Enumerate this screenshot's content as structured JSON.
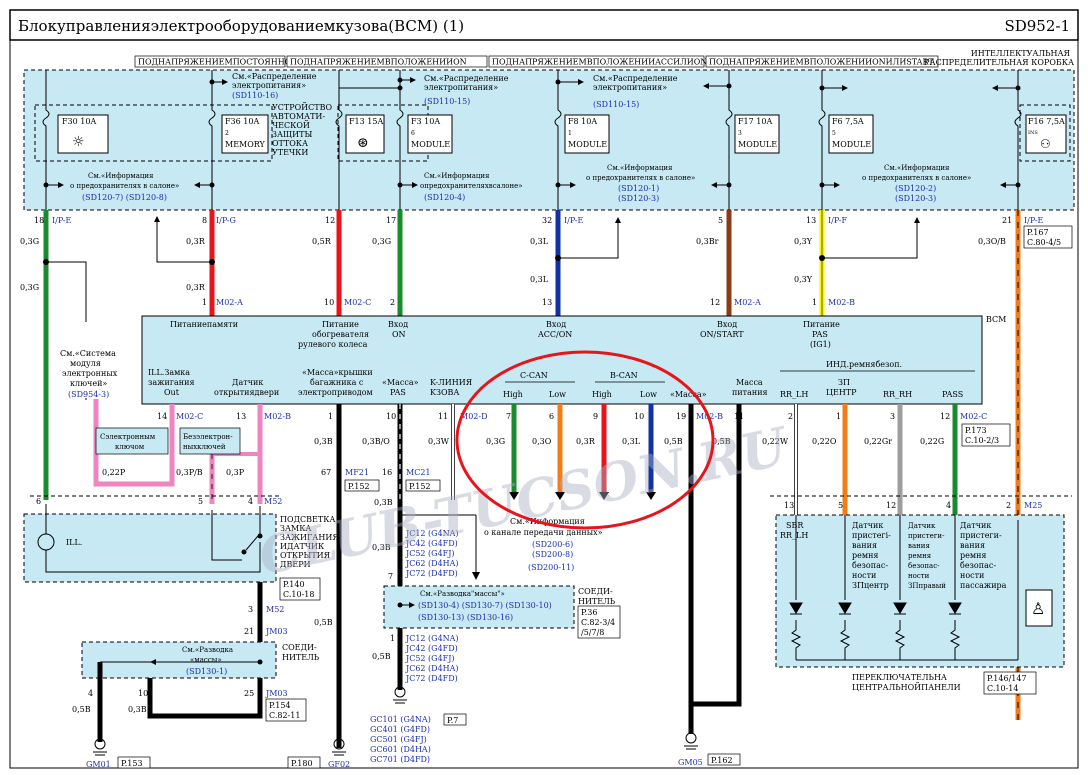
{
  "header": {
    "title": "Блокуправленияэлектрооборудованиемкузова(BCM) (1)",
    "code": "SD952-1"
  },
  "power_labels": [
    "ПОДНАПРЯЖЕНИЕМПОСТОЯННО",
    "ПОДНАПРЯЖЕНИЕМВПОЛОЖЕНИИON",
    "ПОДНАПРЯЖЕНИЕМВПОЛОЖЕНИИACCИЛИON",
    "ПОДНАПРЯЖЕНИЕМВПОЛОЖЕНИИONИЛИSTART"
  ],
  "junction_box": {
    "line1": "ИНТЕЛЛЕКТУАЛЬНАЯ",
    "line2": "РАСПРЕДЕЛИТЕЛЬНАЯ КОРОБКА"
  },
  "fuses": [
    {
      "id": "F30 10A",
      "sub": "",
      "name": ""
    },
    {
      "id": "F36 10A",
      "sub": "2",
      "name": "MEMORY"
    },
    {
      "id": "F13 15A",
      "sub": "",
      "name": ""
    },
    {
      "id": "F3 10A",
      "sub": "6",
      "name": "MODULE"
    },
    {
      "id": "F8 10A",
      "sub": "1",
      "name": "MODULE"
    },
    {
      "id": "F17 10A",
      "sub": "3",
      "name": "MODULE"
    },
    {
      "id": "F6 7,5A",
      "sub": "5",
      "name": "MODULE"
    },
    {
      "id": "F16 7,5A",
      "sub": "INS",
      "name": ""
    }
  ],
  "refs": {
    "dist1": "См.«Распределение",
    "dist2": "электропитания»",
    "dist_sd1": "(SD110-16)",
    "dist_sd2": "(SD110-15)",
    "dist_sd3": "(SD110-15)",
    "leak": [
      "УСТРОЙСТВО",
      "АВТОМАТИ-",
      "ЧЕСКОЙ",
      "ЗАЩИТЫ",
      "ОТТОКА",
      "УТЕЧКИ"
    ],
    "fuseinfo1": "См.«Информация",
    "fuseinfo2": "о предохранителях    в салоне»",
    "fuseinfo2b": "опредохранителяхвсалоне»",
    "fi_sd_a": "(SD120-7)  (SD120-8)",
    "fi_sd_b": "(SD120-4)",
    "fi_sd_c1": "(SD120-1)",
    "fi_sd_c2": "(SD120-3)",
    "fi_sd_d1": "(SD120-2)",
    "fi_sd_d2": "(SD120-3)"
  },
  "wires_top": [
    {
      "pin": "18",
      "conn": "I/P-E",
      "g1": "0,3G",
      "g2": "0,3G"
    },
    {
      "pin": "8",
      "conn": "I/P-G",
      "g1": "0,3R",
      "g2": "0,3R",
      "pin2": "1",
      "conn2": "M02-A"
    },
    {
      "pin": "12",
      "g1": "0,5R",
      "pin2": "10",
      "conn2": "M02-C"
    },
    {
      "pin": "17",
      "g1": "0,3G",
      "pin2": "2"
    },
    {
      "pin": "32",
      "conn": "I/P-E",
      "g1": "0,3L",
      "g2": "0,3L",
      "pin2": "13"
    },
    {
      "pin": "5",
      "g1": "0,3Br",
      "pin2": "12",
      "conn2": "M02-A"
    },
    {
      "pin": "13",
      "conn": "I/P-F",
      "g1": "0,3Y",
      "g2": "0,3Y",
      "pin2": "1",
      "conn2": "M02-B"
    },
    {
      "pin": "21",
      "conn": "I/P-E",
      "g1": "0,3O/B",
      "p1": "P.167",
      "p2": "C.80-4/5"
    }
  ],
  "bcm": {
    "name": "BCM",
    "top": [
      "Питаниепамяти",
      "Питание",
      "обогревателя",
      "рулевого   колеса",
      "Вход",
      "ON",
      "Вход",
      "ACC/ON",
      "Вход",
      "ON/START",
      "Питание",
      "PAS",
      "(IG1)"
    ],
    "ill1": "ILL.Замка",
    "ill2": "зажигания",
    "ill3": "Out",
    "door1": "Датчик",
    "door2": "открытиядвери",
    "trunk1": "«Масса»крышки",
    "trunk2": "багажника  с",
    "trunk3": "электроприводом",
    "mass_pas1": "«Масса»",
    "mass_pas2": "PAS",
    "kline1": "K-ЛИНИЯ",
    "kline2": "KЗОВА",
    "ccan": "C-CAN",
    "bcan": "B-CAN",
    "high": "High",
    "low": "Low",
    "mass": "«Масса»",
    "massp1": "Масса",
    "massp2": "питания",
    "belt": "ИНД.ремнябезоп.",
    "rrlh": "RR_LH",
    "zp1": "ЗП",
    "zp2": "ЦЕНТР",
    "rrrh": "RR_RH",
    "pass": "PASS"
  },
  "wires_bottom": [
    {
      "pin": "14",
      "conn": "M02-C",
      "g": "0,22P"
    },
    {
      "pin": "13",
      "conn": "M02-B",
      "g": "0,3P/B",
      "g2": "0,3P"
    },
    {
      "pin": "1",
      "g": "0,3B",
      "g2": "0,5B"
    },
    {
      "pin": "10",
      "g": "0,3B/O",
      "g2": "0,3B"
    },
    {
      "pin": "11",
      "conn": "M02-D",
      "g": "0,3W"
    },
    {
      "pin": "7",
      "g": "0,3G"
    },
    {
      "pin": "6",
      "g": "0,3O"
    },
    {
      "pin": "9",
      "g": "0,3R"
    },
    {
      "pin": "10",
      "g": "0,3L"
    },
    {
      "pin": "19",
      "conn": "M02-B",
      "g": "0,5B"
    },
    {
      "pin": "11",
      "g": "0,5B"
    },
    {
      "pin": "2",
      "g": "0,22W"
    },
    {
      "pin": "1",
      "g": "0,22O"
    },
    {
      "pin": "3",
      "g": "0,22Gr"
    },
    {
      "pin": "12",
      "conn": "M02-C",
      "g": "0,22G"
    }
  ],
  "left": {
    "keyless_ref": [
      "См.«Система",
      "модуля",
      "электронных",
      "ключей»",
      "(SD954-3)"
    ],
    "with_key": [
      "Сэлектронным",
      "ключом"
    ],
    "without_key": [
      "Безэлектрон-",
      "ныхключей"
    ],
    "ill": "ILL.",
    "door_sw": [
      "ПОДСВЕТКА",
      "ЗАМКА",
      "ЗАЖИГАНИЯ",
      "ИДАТЧИК",
      "ОТКРЫТИЯ",
      "ДВЕРИ"
    ],
    "m52": "M52",
    "pin6": "6",
    "pin5": "5",
    "pin4": "4",
    "p140": "P.140",
    "c1018": "C.10-18",
    "pin3": "3",
    "pin21": "21",
    "jm03": "JM03",
    "ground_ref": [
      "См.«Разводка",
      "«массы»"
    ],
    "sd1301": "(SD130-1)",
    "connector": [
      "СОЕДИ-",
      "НИТЕЛЬ"
    ],
    "p154": "P.154",
    "c8211": "C.82-11",
    "pin4b": "4",
    "pin10": "10",
    "pin25": "25",
    "g05b": "0,5B",
    "g03b": "0,3B",
    "gm01": "GM01",
    "p153": "P.153"
  },
  "center": {
    "mf21": "MF21",
    "p152a": "P.152",
    "mc21": "MC21",
    "p152b": "P.152",
    "pin67": "67",
    "pin16": "16",
    "jc_list": [
      "JC12  (G4NA)",
      "JC42  (G4FD)",
      "JC52  (G4FJ)",
      "JC62  (D4HA)",
      "JC72  (D4FD)"
    ],
    "pin7": "7",
    "pin1": "1",
    "ground_ref": "См.«Разводка\"массы\"»",
    "ground_sd": [
      "(SD130-4)  (SD130-7)  (SD130-10)",
      "(SD130-13)  (SD130-16)"
    ],
    "p36": "P.36",
    "c82": [
      "C.82-3/4",
      "/5/7/8"
    ],
    "gc_list": [
      "GC101  (G4NA)",
      "GC401  (G4FD)",
      "GC501  (G4FJ)",
      "GC601  (D4HA)",
      "GC701  (D4FD)"
    ],
    "p7": "P.7",
    "p180": "P.180",
    "gf02": "GF02",
    "can_info": [
      "См.«Информация",
      "о канале  передачи  данных»"
    ],
    "can_sd": [
      "(SD200-6)",
      "(SD200-8)",
      "(SD200-11)"
    ],
    "gm05": "GM05",
    "p162": "P.162"
  },
  "right": {
    "m25": "M25",
    "pin13": "13",
    "pin5": "5",
    "pin12": "12",
    "pin4": "4",
    "pin2": "2",
    "p173": "P.173",
    "c1023": "C.10-2/3",
    "sbr": [
      "SBR",
      "RR_LH"
    ],
    "s1": [
      "Датчик",
      "пристегі-",
      "вания",
      "ремня",
      "безопас-",
      "ности",
      "ЗПцентр"
    ],
    "s2": [
      "Датчик",
      "пристеги-",
      "вания",
      "ремня",
      "безопас-",
      "ности",
      "ЗПправый"
    ],
    "s3": [
      "Датчик",
      "пристеги-",
      "вания",
      "ремня",
      "безопас-",
      "ности",
      "пассажира"
    ],
    "panel": [
      "ПЕРЕКЛЮЧАТЕЛЬНА",
      "ЦЕНТРАЛЬНОЙПАНЕЛИ"
    ],
    "p146": "P.146/147",
    "c1014": "C.10-14"
  },
  "watermark": "CLUB-TUCSON.RU",
  "colors": {
    "panel": "#c7e9f3",
    "red": "#e8141b",
    "green": "#1a8a2e",
    "blue": "#1232a3",
    "orange": "#f07d17",
    "yellow": "#f7f200",
    "brown": "#8a3a17",
    "pink": "#ef84c2",
    "grey": "#9d9d9d",
    "black": "#000000",
    "watermark": "#aab0c4"
  }
}
